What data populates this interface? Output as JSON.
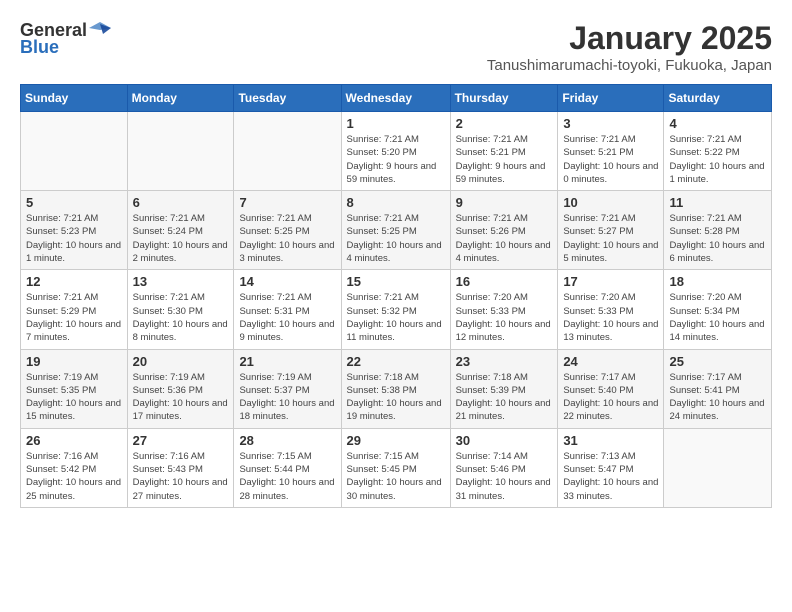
{
  "header": {
    "logo_general": "General",
    "logo_blue": "Blue",
    "title": "January 2025",
    "subtitle": "Tanushimarumachi-toyoki, Fukuoka, Japan"
  },
  "weekdays": [
    "Sunday",
    "Monday",
    "Tuesday",
    "Wednesday",
    "Thursday",
    "Friday",
    "Saturday"
  ],
  "weeks": [
    [
      {
        "day": "",
        "info": ""
      },
      {
        "day": "",
        "info": ""
      },
      {
        "day": "",
        "info": ""
      },
      {
        "day": "1",
        "info": "Sunrise: 7:21 AM\nSunset: 5:20 PM\nDaylight: 9 hours and 59 minutes."
      },
      {
        "day": "2",
        "info": "Sunrise: 7:21 AM\nSunset: 5:21 PM\nDaylight: 9 hours and 59 minutes."
      },
      {
        "day": "3",
        "info": "Sunrise: 7:21 AM\nSunset: 5:21 PM\nDaylight: 10 hours and 0 minutes."
      },
      {
        "day": "4",
        "info": "Sunrise: 7:21 AM\nSunset: 5:22 PM\nDaylight: 10 hours and 1 minute."
      }
    ],
    [
      {
        "day": "5",
        "info": "Sunrise: 7:21 AM\nSunset: 5:23 PM\nDaylight: 10 hours and 1 minute."
      },
      {
        "day": "6",
        "info": "Sunrise: 7:21 AM\nSunset: 5:24 PM\nDaylight: 10 hours and 2 minutes."
      },
      {
        "day": "7",
        "info": "Sunrise: 7:21 AM\nSunset: 5:25 PM\nDaylight: 10 hours and 3 minutes."
      },
      {
        "day": "8",
        "info": "Sunrise: 7:21 AM\nSunset: 5:25 PM\nDaylight: 10 hours and 4 minutes."
      },
      {
        "day": "9",
        "info": "Sunrise: 7:21 AM\nSunset: 5:26 PM\nDaylight: 10 hours and 4 minutes."
      },
      {
        "day": "10",
        "info": "Sunrise: 7:21 AM\nSunset: 5:27 PM\nDaylight: 10 hours and 5 minutes."
      },
      {
        "day": "11",
        "info": "Sunrise: 7:21 AM\nSunset: 5:28 PM\nDaylight: 10 hours and 6 minutes."
      }
    ],
    [
      {
        "day": "12",
        "info": "Sunrise: 7:21 AM\nSunset: 5:29 PM\nDaylight: 10 hours and 7 minutes."
      },
      {
        "day": "13",
        "info": "Sunrise: 7:21 AM\nSunset: 5:30 PM\nDaylight: 10 hours and 8 minutes."
      },
      {
        "day": "14",
        "info": "Sunrise: 7:21 AM\nSunset: 5:31 PM\nDaylight: 10 hours and 9 minutes."
      },
      {
        "day": "15",
        "info": "Sunrise: 7:21 AM\nSunset: 5:32 PM\nDaylight: 10 hours and 11 minutes."
      },
      {
        "day": "16",
        "info": "Sunrise: 7:20 AM\nSunset: 5:33 PM\nDaylight: 10 hours and 12 minutes."
      },
      {
        "day": "17",
        "info": "Sunrise: 7:20 AM\nSunset: 5:33 PM\nDaylight: 10 hours and 13 minutes."
      },
      {
        "day": "18",
        "info": "Sunrise: 7:20 AM\nSunset: 5:34 PM\nDaylight: 10 hours and 14 minutes."
      }
    ],
    [
      {
        "day": "19",
        "info": "Sunrise: 7:19 AM\nSunset: 5:35 PM\nDaylight: 10 hours and 15 minutes."
      },
      {
        "day": "20",
        "info": "Sunrise: 7:19 AM\nSunset: 5:36 PM\nDaylight: 10 hours and 17 minutes."
      },
      {
        "day": "21",
        "info": "Sunrise: 7:19 AM\nSunset: 5:37 PM\nDaylight: 10 hours and 18 minutes."
      },
      {
        "day": "22",
        "info": "Sunrise: 7:18 AM\nSunset: 5:38 PM\nDaylight: 10 hours and 19 minutes."
      },
      {
        "day": "23",
        "info": "Sunrise: 7:18 AM\nSunset: 5:39 PM\nDaylight: 10 hours and 21 minutes."
      },
      {
        "day": "24",
        "info": "Sunrise: 7:17 AM\nSunset: 5:40 PM\nDaylight: 10 hours and 22 minutes."
      },
      {
        "day": "25",
        "info": "Sunrise: 7:17 AM\nSunset: 5:41 PM\nDaylight: 10 hours and 24 minutes."
      }
    ],
    [
      {
        "day": "26",
        "info": "Sunrise: 7:16 AM\nSunset: 5:42 PM\nDaylight: 10 hours and 25 minutes."
      },
      {
        "day": "27",
        "info": "Sunrise: 7:16 AM\nSunset: 5:43 PM\nDaylight: 10 hours and 27 minutes."
      },
      {
        "day": "28",
        "info": "Sunrise: 7:15 AM\nSunset: 5:44 PM\nDaylight: 10 hours and 28 minutes."
      },
      {
        "day": "29",
        "info": "Sunrise: 7:15 AM\nSunset: 5:45 PM\nDaylight: 10 hours and 30 minutes."
      },
      {
        "day": "30",
        "info": "Sunrise: 7:14 AM\nSunset: 5:46 PM\nDaylight: 10 hours and 31 minutes."
      },
      {
        "day": "31",
        "info": "Sunrise: 7:13 AM\nSunset: 5:47 PM\nDaylight: 10 hours and 33 minutes."
      },
      {
        "day": "",
        "info": ""
      }
    ]
  ]
}
